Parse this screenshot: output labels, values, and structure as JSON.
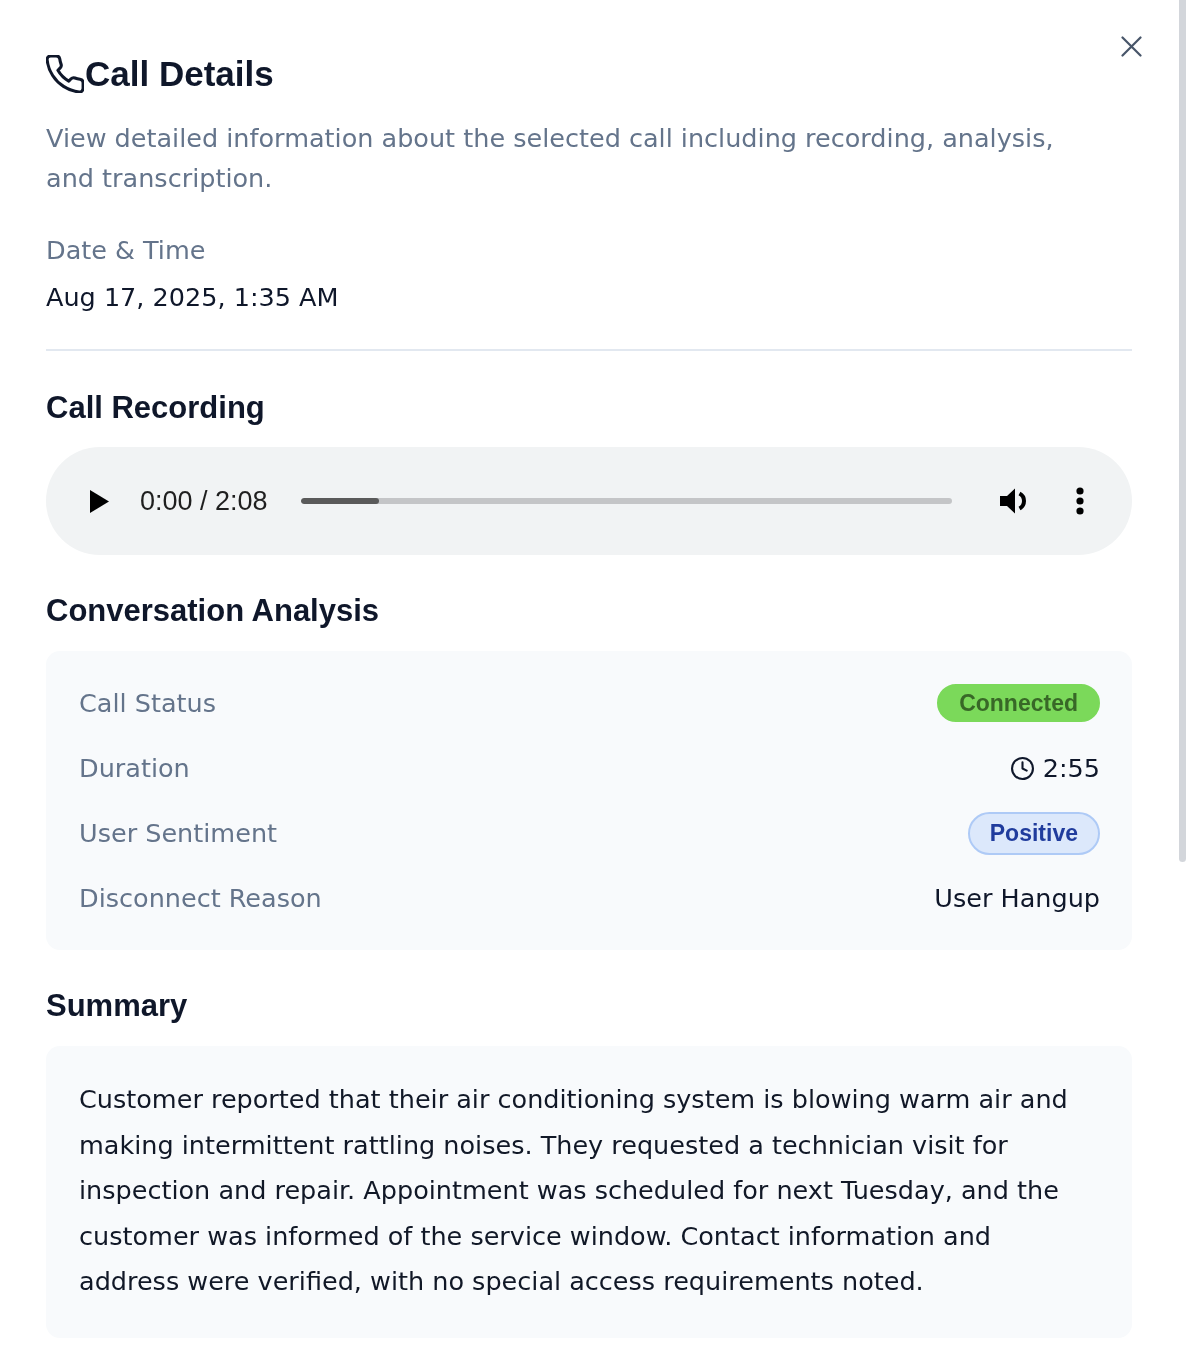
{
  "dialog": {
    "title": "Call Details",
    "description": "View detailed information about the selected call including recording, analysis, and transcription."
  },
  "date_time": {
    "label": "Date & Time",
    "value": "Aug 17, 2025, 1:35 AM"
  },
  "call_recording": {
    "heading": "Call Recording",
    "player": {
      "time": "0:00 / 2:08",
      "level": 0.12
    }
  },
  "conversation_analysis": {
    "heading": "Conversation Analysis",
    "rows": [
      {
        "label": "Call Status",
        "kind": "badge",
        "value": "Connected",
        "color": "#7bd95a"
      },
      {
        "label": "Duration",
        "kind": "duration",
        "value": "2:55"
      },
      {
        "label": "User Sentiment",
        "kind": "chip",
        "value": "Positive",
        "color": "#dce8fb"
      },
      {
        "label": "Disconnect Reason",
        "kind": "text",
        "value": "User Hangup"
      }
    ]
  },
  "summary": {
    "heading": "Summary",
    "text": "Customer reported that their air conditioning system is blowing warm air and making intermittent rattling noises. They requested a technician visit for inspection and repair. Appointment was scheduled for next Tuesday, and the customer was informed of the service window. Contact information and address were verified, with no special access requirements noted."
  }
}
